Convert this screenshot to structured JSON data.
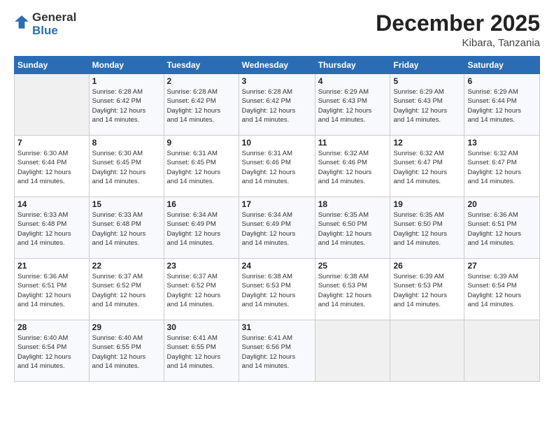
{
  "logo": {
    "general": "General",
    "blue": "Blue"
  },
  "title": "December 2025",
  "location": "Kibara, Tanzania",
  "days_header": [
    "Sunday",
    "Monday",
    "Tuesday",
    "Wednesday",
    "Thursday",
    "Friday",
    "Saturday"
  ],
  "weeks": [
    [
      {
        "day": "",
        "info": ""
      },
      {
        "day": "1",
        "info": "Sunrise: 6:28 AM\nSunset: 6:42 PM\nDaylight: 12 hours\nand 14 minutes."
      },
      {
        "day": "2",
        "info": "Sunrise: 6:28 AM\nSunset: 6:42 PM\nDaylight: 12 hours\nand 14 minutes."
      },
      {
        "day": "3",
        "info": "Sunrise: 6:28 AM\nSunset: 6:42 PM\nDaylight: 12 hours\nand 14 minutes."
      },
      {
        "day": "4",
        "info": "Sunrise: 6:29 AM\nSunset: 6:43 PM\nDaylight: 12 hours\nand 14 minutes."
      },
      {
        "day": "5",
        "info": "Sunrise: 6:29 AM\nSunset: 6:43 PM\nDaylight: 12 hours\nand 14 minutes."
      },
      {
        "day": "6",
        "info": "Sunrise: 6:29 AM\nSunset: 6:44 PM\nDaylight: 12 hours\nand 14 minutes."
      }
    ],
    [
      {
        "day": "7",
        "info": "Sunrise: 6:30 AM\nSunset: 6:44 PM\nDaylight: 12 hours\nand 14 minutes."
      },
      {
        "day": "8",
        "info": "Sunrise: 6:30 AM\nSunset: 6:45 PM\nDaylight: 12 hours\nand 14 minutes."
      },
      {
        "day": "9",
        "info": "Sunrise: 6:31 AM\nSunset: 6:45 PM\nDaylight: 12 hours\nand 14 minutes."
      },
      {
        "day": "10",
        "info": "Sunrise: 6:31 AM\nSunset: 6:46 PM\nDaylight: 12 hours\nand 14 minutes."
      },
      {
        "day": "11",
        "info": "Sunrise: 6:32 AM\nSunset: 6:46 PM\nDaylight: 12 hours\nand 14 minutes."
      },
      {
        "day": "12",
        "info": "Sunrise: 6:32 AM\nSunset: 6:47 PM\nDaylight: 12 hours\nand 14 minutes."
      },
      {
        "day": "13",
        "info": "Sunrise: 6:32 AM\nSunset: 6:47 PM\nDaylight: 12 hours\nand 14 minutes."
      }
    ],
    [
      {
        "day": "14",
        "info": "Sunrise: 6:33 AM\nSunset: 6:48 PM\nDaylight: 12 hours\nand 14 minutes."
      },
      {
        "day": "15",
        "info": "Sunrise: 6:33 AM\nSunset: 6:48 PM\nDaylight: 12 hours\nand 14 minutes."
      },
      {
        "day": "16",
        "info": "Sunrise: 6:34 AM\nSunset: 6:49 PM\nDaylight: 12 hours\nand 14 minutes."
      },
      {
        "day": "17",
        "info": "Sunrise: 6:34 AM\nSunset: 6:49 PM\nDaylight: 12 hours\nand 14 minutes."
      },
      {
        "day": "18",
        "info": "Sunrise: 6:35 AM\nSunset: 6:50 PM\nDaylight: 12 hours\nand 14 minutes."
      },
      {
        "day": "19",
        "info": "Sunrise: 6:35 AM\nSunset: 6:50 PM\nDaylight: 12 hours\nand 14 minutes."
      },
      {
        "day": "20",
        "info": "Sunrise: 6:36 AM\nSunset: 6:51 PM\nDaylight: 12 hours\nand 14 minutes."
      }
    ],
    [
      {
        "day": "21",
        "info": "Sunrise: 6:36 AM\nSunset: 6:51 PM\nDaylight: 12 hours\nand 14 minutes."
      },
      {
        "day": "22",
        "info": "Sunrise: 6:37 AM\nSunset: 6:52 PM\nDaylight: 12 hours\nand 14 minutes."
      },
      {
        "day": "23",
        "info": "Sunrise: 6:37 AM\nSunset: 6:52 PM\nDaylight: 12 hours\nand 14 minutes."
      },
      {
        "day": "24",
        "info": "Sunrise: 6:38 AM\nSunset: 6:53 PM\nDaylight: 12 hours\nand 14 minutes."
      },
      {
        "day": "25",
        "info": "Sunrise: 6:38 AM\nSunset: 6:53 PM\nDaylight: 12 hours\nand 14 minutes."
      },
      {
        "day": "26",
        "info": "Sunrise: 6:39 AM\nSunset: 6:53 PM\nDaylight: 12 hours\nand 14 minutes."
      },
      {
        "day": "27",
        "info": "Sunrise: 6:39 AM\nSunset: 6:54 PM\nDaylight: 12 hours\nand 14 minutes."
      }
    ],
    [
      {
        "day": "28",
        "info": "Sunrise: 6:40 AM\nSunset: 6:54 PM\nDaylight: 12 hours\nand 14 minutes."
      },
      {
        "day": "29",
        "info": "Sunrise: 6:40 AM\nSunset: 6:55 PM\nDaylight: 12 hours\nand 14 minutes."
      },
      {
        "day": "30",
        "info": "Sunrise: 6:41 AM\nSunset: 6:55 PM\nDaylight: 12 hours\nand 14 minutes."
      },
      {
        "day": "31",
        "info": "Sunrise: 6:41 AM\nSunset: 6:56 PM\nDaylight: 12 hours\nand 14 minutes."
      },
      {
        "day": "",
        "info": ""
      },
      {
        "day": "",
        "info": ""
      },
      {
        "day": "",
        "info": ""
      }
    ]
  ]
}
